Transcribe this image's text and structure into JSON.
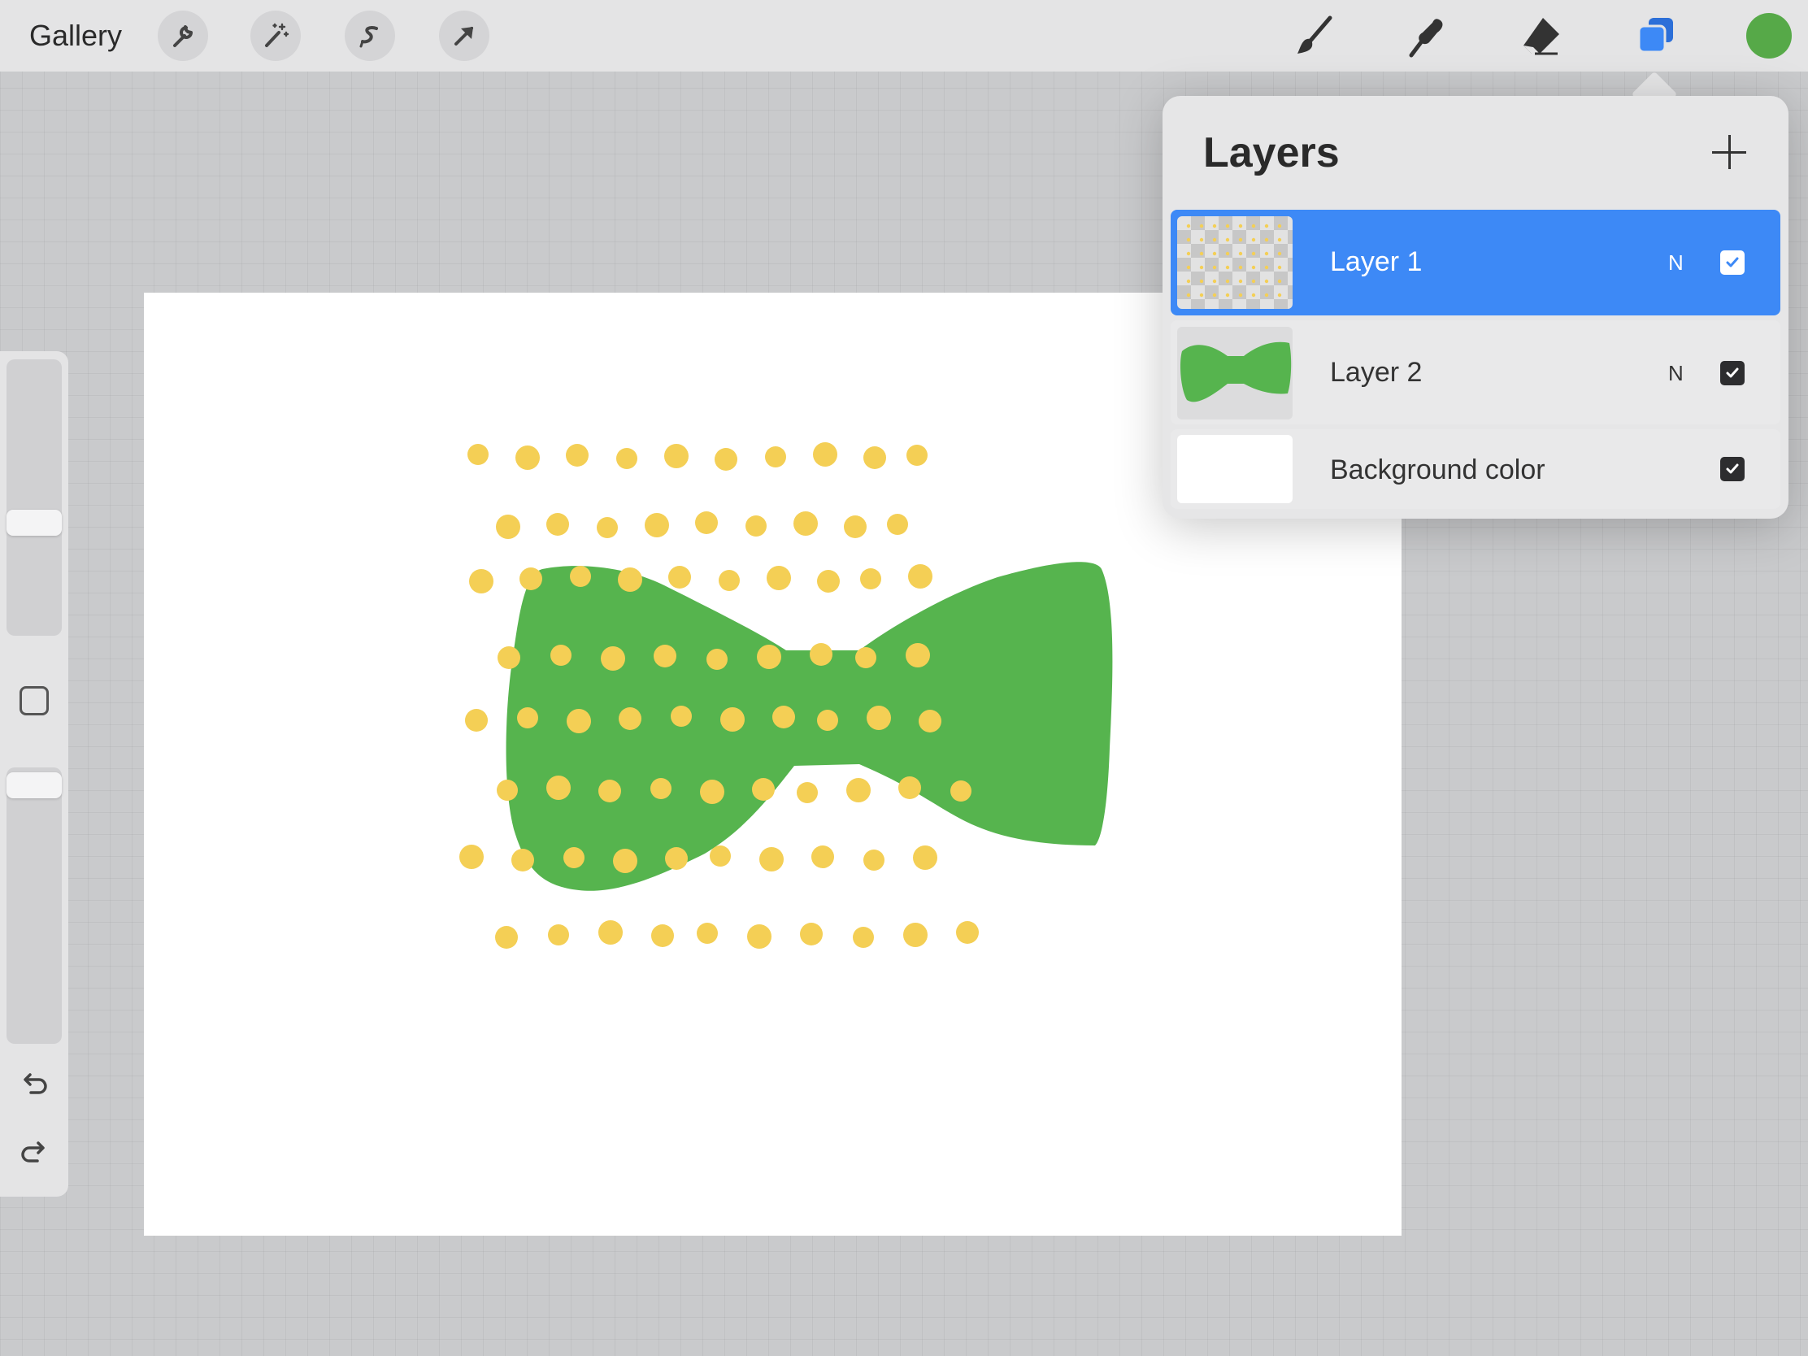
{
  "toolbar": {
    "gallery_label": "Gallery",
    "left_tools": [
      "wrench-icon",
      "magic-wand-icon",
      "selection-icon",
      "transform-arrow-icon"
    ],
    "right_tools": [
      "brush-icon",
      "smudge-icon",
      "eraser-icon",
      "layers-icon"
    ],
    "active_tool": "layers-icon",
    "current_color": "#56a948"
  },
  "sidebar": {
    "brush_size_level": 0.4,
    "opacity_level": 0.02,
    "icons": [
      "modify-button-icon",
      "undo-icon",
      "redo-icon"
    ]
  },
  "layers_panel": {
    "title": "Layers",
    "add_icon": "plus-icon",
    "layers": [
      {
        "name": "Layer 1",
        "blend_mode": "N",
        "visible": true,
        "selected": true
      },
      {
        "name": "Layer 2",
        "blend_mode": "N",
        "visible": true,
        "selected": false
      },
      {
        "name": "Background color",
        "visible": true,
        "selected": false
      }
    ]
  },
  "colors": {
    "accent": "#3d89f6",
    "bowtie_green": "#56b44e",
    "dot_yellow": "#f4cf55",
    "canvas": "#ffffff"
  }
}
